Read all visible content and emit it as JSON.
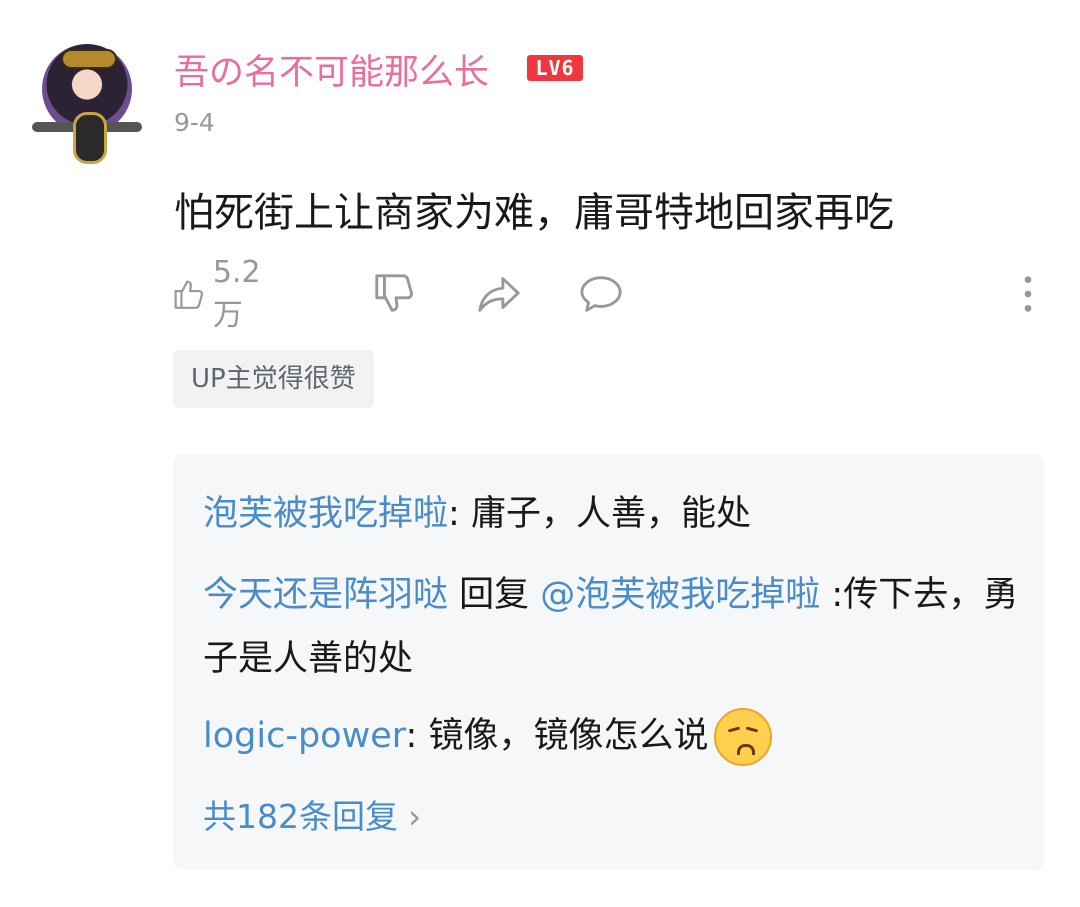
{
  "comment": {
    "username": "吾の名不可能那么长",
    "level": "LV6",
    "date": "9-4",
    "text": "怕死街上让商家为难，庸哥特地回家再吃",
    "like_count": "5.2万",
    "up_tag": "UP主觉得很赞"
  },
  "replies": [
    {
      "user": "泡芙被我吃掉啦",
      "separator": ": ",
      "text": "庸子，人善，能处"
    },
    {
      "user": "今天还是阵羽哒",
      "reply_word": " 回复 ",
      "mention": "@泡芙被我吃掉啦",
      "text": " :传下去，勇子是人善的处"
    },
    {
      "user": "logic-power",
      "separator": ": ",
      "text": "镜像，镜像怎么说",
      "emoji": "angry-face-emoji"
    }
  ],
  "more_replies": "共182条回复",
  "colors": {
    "username_pink": "#e96e9c",
    "level_red": "#f0373f",
    "link_blue": "#4a8cc9",
    "muted_gray": "#9499a0",
    "reply_bg": "#f6f7f8"
  },
  "icons": [
    "avatar",
    "like-icon",
    "dislike-icon",
    "share-icon",
    "comment-icon",
    "more-icon",
    "chevron-right-icon"
  ]
}
